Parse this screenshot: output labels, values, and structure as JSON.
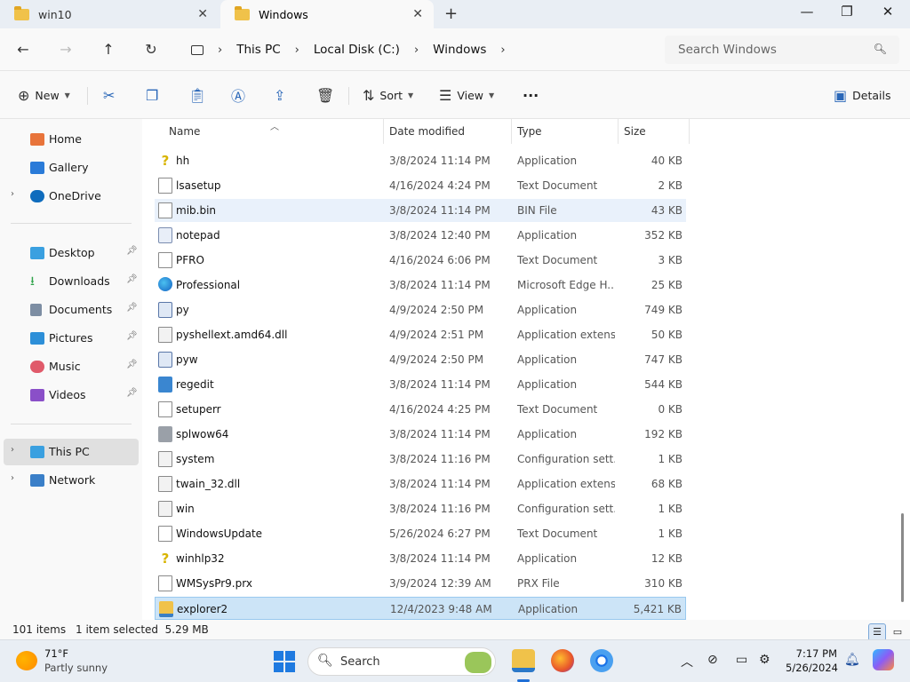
{
  "tabs": [
    {
      "label": "win10"
    },
    {
      "label": "Windows"
    }
  ],
  "breadcrumb": [
    "This PC",
    "Local Disk (C:)",
    "Windows"
  ],
  "search": {
    "placeholder": "Search Windows"
  },
  "toolbar": {
    "new_label": "New",
    "sort_label": "Sort",
    "view_label": "View",
    "more_label": "···",
    "details_label": "Details"
  },
  "sidebar": {
    "items": [
      {
        "label": "Home",
        "icon": "home-icon",
        "color": "#e8743b"
      },
      {
        "label": "Gallery",
        "icon": "gallery-icon",
        "color": "#2a7bd8"
      },
      {
        "label": "OneDrive",
        "icon": "cloud-icon",
        "color": "#0f6cbd"
      },
      {
        "label": "Desktop",
        "icon": "desktop-icon",
        "color": "#3aa0e0"
      },
      {
        "label": "Downloads",
        "icon": "download-icon",
        "color": "#2fa34a"
      },
      {
        "label": "Documents",
        "icon": "documents-icon",
        "color": "#7d8ea3"
      },
      {
        "label": "Pictures",
        "icon": "pictures-icon",
        "color": "#2d8fd8"
      },
      {
        "label": "Music",
        "icon": "music-icon",
        "color": "#e05a6a"
      },
      {
        "label": "Videos",
        "icon": "videos-icon",
        "color": "#8a4fc8"
      },
      {
        "label": "This PC",
        "icon": "pc-icon",
        "color": "#3aa0e0"
      },
      {
        "label": "Network",
        "icon": "network-icon",
        "color": "#3a7fc8"
      }
    ]
  },
  "columns": {
    "name": "Name",
    "date": "Date modified",
    "type": "Type",
    "size": "Size"
  },
  "files": [
    {
      "name": "hh",
      "date": "3/8/2024 11:14 PM",
      "type": "Application",
      "size": "40 KB",
      "icon": "help-icon"
    },
    {
      "name": "lsasetup",
      "date": "4/16/2024 4:24 PM",
      "type": "Text Document",
      "size": "2 KB",
      "icon": "document-icon"
    },
    {
      "name": "mib.bin",
      "date": "3/8/2024 11:14 PM",
      "type": "BIN File",
      "size": "43 KB",
      "icon": "file-icon"
    },
    {
      "name": "notepad",
      "date": "3/8/2024 12:40 PM",
      "type": "Application",
      "size": "352 KB",
      "icon": "notepad-icon"
    },
    {
      "name": "PFRO",
      "date": "4/16/2024 6:06 PM",
      "type": "Text Document",
      "size": "3 KB",
      "icon": "document-icon"
    },
    {
      "name": "Professional",
      "date": "3/8/2024 11:14 PM",
      "type": "Microsoft Edge H...",
      "size": "25 KB",
      "icon": "edge-icon"
    },
    {
      "name": "py",
      "date": "4/9/2024 2:50 PM",
      "type": "Application",
      "size": "749 KB",
      "icon": "python-icon"
    },
    {
      "name": "pyshellext.amd64.dll",
      "date": "4/9/2024 2:51 PM",
      "type": "Application extens...",
      "size": "50 KB",
      "icon": "dll-icon"
    },
    {
      "name": "pyw",
      "date": "4/9/2024 2:50 PM",
      "type": "Application",
      "size": "747 KB",
      "icon": "python-icon"
    },
    {
      "name": "regedit",
      "date": "3/8/2024 11:14 PM",
      "type": "Application",
      "size": "544 KB",
      "icon": "registry-icon"
    },
    {
      "name": "setuperr",
      "date": "4/16/2024 4:25 PM",
      "type": "Text Document",
      "size": "0 KB",
      "icon": "document-icon"
    },
    {
      "name": "splwow64",
      "date": "3/8/2024 11:14 PM",
      "type": "Application",
      "size": "192 KB",
      "icon": "printer-icon"
    },
    {
      "name": "system",
      "date": "3/8/2024 11:16 PM",
      "type": "Configuration sett...",
      "size": "1 KB",
      "icon": "config-icon"
    },
    {
      "name": "twain_32.dll",
      "date": "3/8/2024 11:14 PM",
      "type": "Application extens...",
      "size": "68 KB",
      "icon": "dll-icon"
    },
    {
      "name": "win",
      "date": "3/8/2024 11:16 PM",
      "type": "Configuration sett...",
      "size": "1 KB",
      "icon": "config-icon"
    },
    {
      "name": "WindowsUpdate",
      "date": "5/26/2024 6:27 PM",
      "type": "Text Document",
      "size": "1 KB",
      "icon": "document-icon"
    },
    {
      "name": "winhlp32",
      "date": "3/8/2024 11:14 PM",
      "type": "Application",
      "size": "12 KB",
      "icon": "help-icon"
    },
    {
      "name": "WMSysPr9.prx",
      "date": "3/9/2024 12:39 AM",
      "type": "PRX File",
      "size": "310 KB",
      "icon": "file-icon"
    },
    {
      "name": "explorer2",
      "date": "12/4/2023 9:48 AM",
      "type": "Application",
      "size": "5,421 KB",
      "icon": "explorer-icon"
    }
  ],
  "status": {
    "count": "101 items",
    "selection": "1 item selected  5.29 MB"
  },
  "taskbar": {
    "temp": "71°F",
    "weather": "Partly sunny",
    "search_label": "Search",
    "time": "7:17 PM",
    "date": "5/26/2024"
  }
}
